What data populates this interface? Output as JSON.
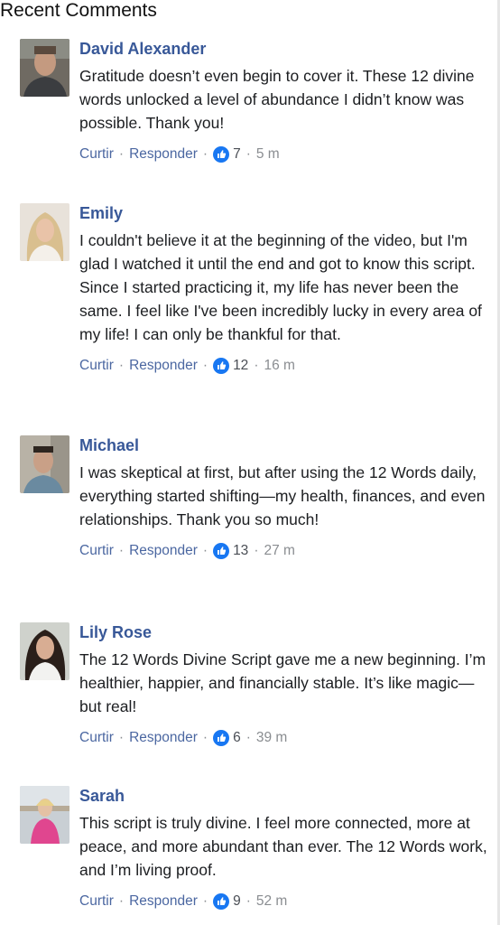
{
  "section_title": "Recent Comments",
  "colors": {
    "link": "#385898",
    "like_blue": "#1877f2"
  },
  "comments": [
    {
      "author": "David Alexander",
      "text": "Gratitude doesn’t even begin to cover it. These 12 divine words unlocked a level of abundance I didn’t know was possible. Thank you!",
      "like_label": "Curtir",
      "reply_label": "Responder",
      "likes": "7",
      "time": "5 m"
    },
    {
      "author": "Emily",
      "text": "I couldn't believe it at the beginning of the video, but I'm glad I watched it until the end and got to know this script. Since I started practicing it, my life has never been the same. I feel like I've been incredibly lucky in every area of my life! I can only be thankful for that.",
      "like_label": "Curtir",
      "reply_label": "Responder",
      "likes": "12",
      "time": "16 m"
    },
    {
      "author": "Michael",
      "text": "I was skeptical at first, but after using the 12 Words daily, everything started shifting—my health, finances, and even relationships. Thank you so much!",
      "like_label": "Curtir",
      "reply_label": "Responder",
      "likes": "13",
      "time": "27 m"
    },
    {
      "author": "Lily Rose",
      "text": "The 12 Words Divine Script gave me a new beginning. I’m healthier, happier, and financially stable. It’s like magic—but real!",
      "like_label": "Curtir",
      "reply_label": "Responder",
      "likes": "6",
      "time": "39 m"
    },
    {
      "author": "Sarah",
      "text": "This script is truly divine. I feel more connected, more at peace, and more abundant than ever. The 12 Words work, and I’m living proof.",
      "like_label": "Curtir",
      "reply_label": "Responder",
      "likes": "9",
      "time": "52 m"
    }
  ]
}
